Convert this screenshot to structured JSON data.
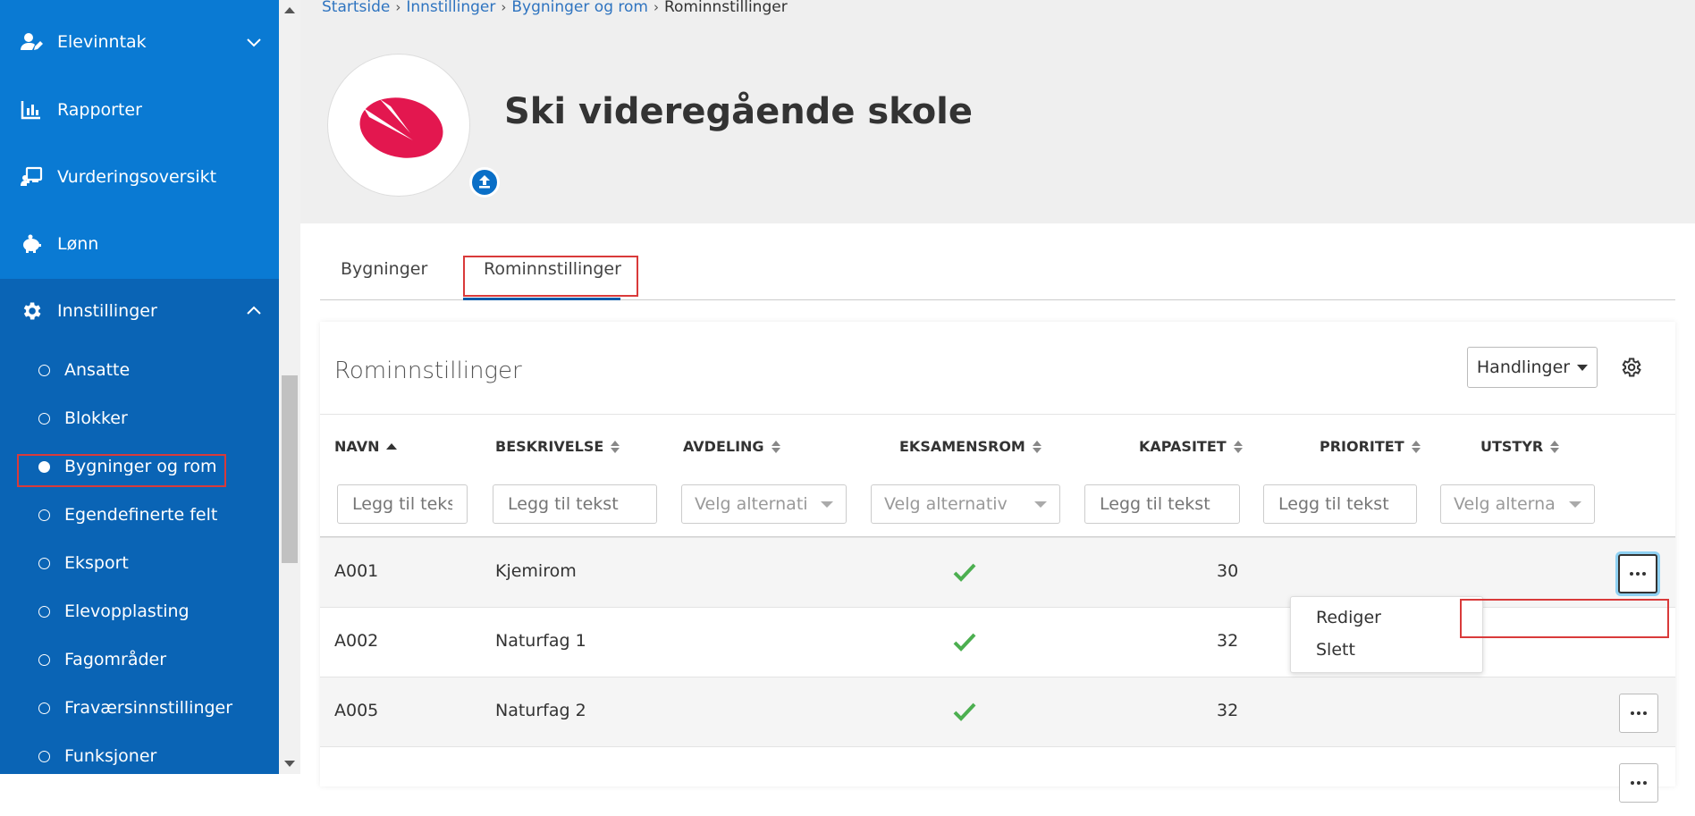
{
  "sidebar": {
    "items": [
      {
        "label": "Elevinntak",
        "icon": "user-edit-icon",
        "chevron": "down"
      },
      {
        "label": "Rapporter",
        "icon": "bar-chart-icon"
      },
      {
        "label": "Vurderingsoversikt",
        "icon": "chalkboard-user-icon"
      },
      {
        "label": "Lønn",
        "icon": "piggy-bank-icon"
      },
      {
        "label": "Innstillinger",
        "icon": "gear-icon",
        "chevron": "up"
      }
    ],
    "subitems": [
      {
        "label": "Ansatte"
      },
      {
        "label": "Blokker"
      },
      {
        "label": "Bygninger og rom",
        "active": true
      },
      {
        "label": "Egendefinerte felt"
      },
      {
        "label": "Eksport"
      },
      {
        "label": "Elevopplasting"
      },
      {
        "label": "Fagområder"
      },
      {
        "label": "Fraværsinnstillinger"
      },
      {
        "label": "Funksjoner"
      }
    ]
  },
  "breadcrumb": [
    "Startside",
    "Innstillinger",
    "Bygninger og rom",
    "Rominnstillinger"
  ],
  "school": {
    "name": "Ski videregående skole"
  },
  "tabs": [
    "Bygninger",
    "Rominnstillinger"
  ],
  "panel": {
    "title": "Rominnstillinger",
    "actions_label": "Handlinger"
  },
  "table": {
    "columns": [
      "NAVN",
      "BESKRIVELSE",
      "AVDELING",
      "EKSAMENSROM",
      "KAPASITET",
      "PRIORITET",
      "UTSTYR"
    ],
    "filters": {
      "text_placeholder": "Legg til tekst",
      "avdeling_placeholder": "Velg alternati",
      "eksamensrom_placeholder": "Velg alternativ",
      "utstyr_placeholder": "Velg alterna"
    },
    "rows": [
      {
        "navn": "A001",
        "beskrivelse": "Kjemirom",
        "eksamensrom": true,
        "kapasitet": "30"
      },
      {
        "navn": "A002",
        "beskrivelse": "Naturfag 1",
        "eksamensrom": true,
        "kapasitet": "32"
      },
      {
        "navn": "A005",
        "beskrivelse": "Naturfag 2",
        "eksamensrom": true,
        "kapasitet": "32"
      }
    ]
  },
  "row_menu": {
    "items": [
      "Rediger",
      "Slett"
    ]
  },
  "colors": {
    "sidebar_top": "#0a7ad3",
    "sidebar_sub": "#0a64b5",
    "logo_red": "#e3174f",
    "check_green": "#4caf50",
    "highlight_red": "#d93a3a"
  }
}
